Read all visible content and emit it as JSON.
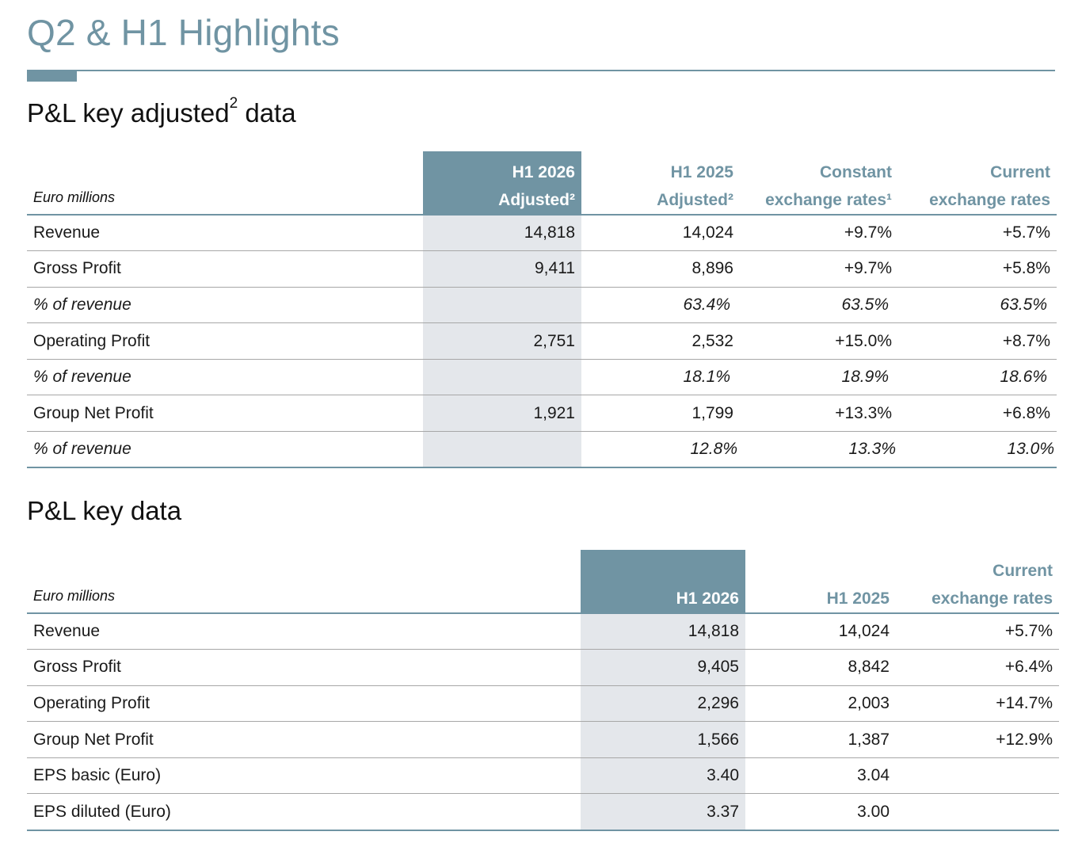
{
  "page": {
    "title": "Q2 & H1 Highlights"
  },
  "adjusted_section": {
    "heading": "P&L key adjusted",
    "heading_sup": "2",
    "heading_suffix": " data",
    "unit": "Euro millions",
    "columns": [
      {
        "line1": "H1 2026",
        "line2": "Adjusted²"
      },
      {
        "line1": "H1 2025",
        "line2": "Adjusted²"
      },
      {
        "line1": "Constant",
        "line2": "exchange rates¹"
      },
      {
        "line1": "Current",
        "line2": "exchange rates"
      }
    ],
    "rows": [
      {
        "label": "Revenue",
        "values": [
          "14,818",
          "14,024",
          "+9.7%",
          "+5.7%"
        ]
      },
      {
        "label": "Gross Profit",
        "values": [
          "9,411",
          "8,896",
          "+9.7%",
          "+5.8%"
        ]
      },
      {
        "label": "% of revenue",
        "values": [
          "",
          "63.4%",
          "63.5%",
          "63.5%"
        ]
      },
      {
        "label": "Operating Profit",
        "values": [
          "2,751",
          "2,532",
          "+15.0%",
          "+8.7%"
        ]
      },
      {
        "label": "% of revenue",
        "values": [
          "",
          "18.1%",
          "18.9%",
          "18.6%"
        ]
      },
      {
        "label": "Group Net Profit",
        "values": [
          "1,921",
          "1,799",
          "+13.3%",
          "+6.8%"
        ]
      },
      {
        "label": "% of revenue",
        "values": [
          "",
          "12.8%",
          "13.3%",
          "13.0%"
        ]
      }
    ]
  },
  "key_section": {
    "heading": "P&L key data",
    "unit": "Euro millions",
    "columns": [
      {
        "line1": "",
        "line2": "H1 2026"
      },
      {
        "line1": "",
        "line2": "H1 2025"
      },
      {
        "line1": "Current",
        "line2": "exchange rates"
      }
    ],
    "rows": [
      {
        "label": "Revenue",
        "values": [
          "14,818",
          "14,024",
          "+5.7%"
        ]
      },
      {
        "label": "Gross Profit",
        "values": [
          "9,405",
          "8,842",
          "+6.4%"
        ]
      },
      {
        "label": "Operating Profit",
        "values": [
          "2,296",
          "2,003",
          "+14.7%"
        ]
      },
      {
        "label": "Group Net Profit",
        "values": [
          "1,566",
          "1,387",
          "+12.9%"
        ]
      },
      {
        "label": "EPS basic (Euro)",
        "values": [
          "3.40",
          "3.04",
          ""
        ]
      },
      {
        "label": "EPS diluted (Euro)",
        "values": [
          "3.37",
          "3.00",
          ""
        ]
      }
    ]
  },
  "colors": {
    "accent": "#7094a3",
    "highlight_column": "#e4e7eb",
    "row_rule": "#a7a7a7"
  }
}
